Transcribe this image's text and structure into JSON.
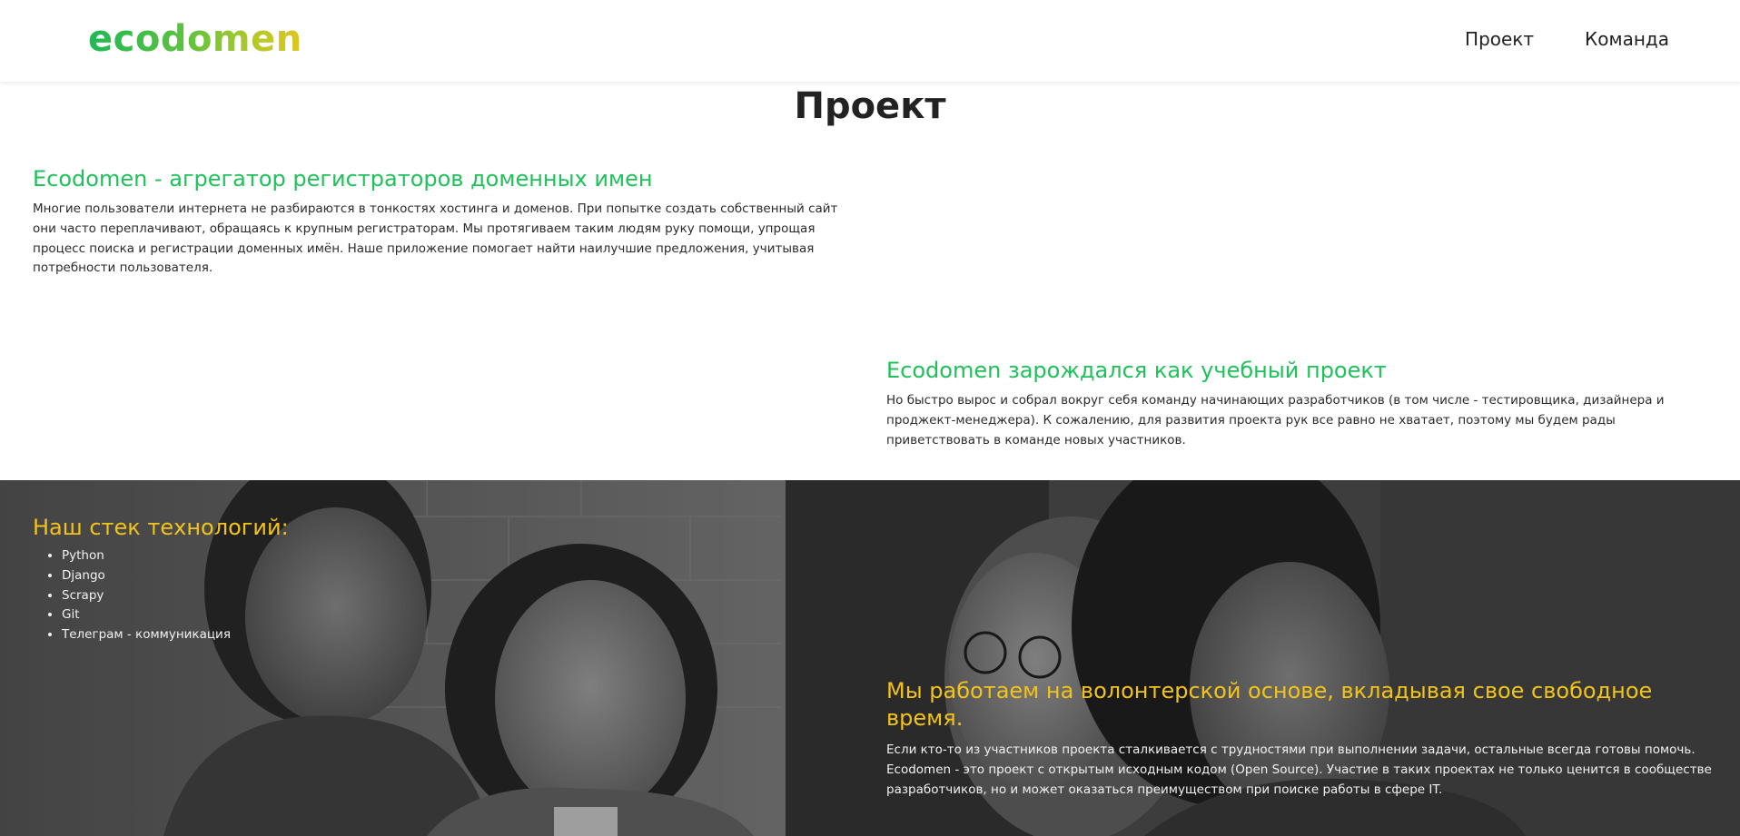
{
  "header": {
    "logo": "ecodomen",
    "nav": [
      {
        "label": "Проект"
      },
      {
        "label": "Команда"
      }
    ]
  },
  "page": {
    "title": "Проект"
  },
  "sections": {
    "aggregator": {
      "title": "Ecodomen - агрегатор регистраторов доменных имен",
      "text": "Многие пользователи интернета не разбираются в тонкостях хостинга и доменов. При попытке создать собственный сайт они часто переплачивают, обращаясь к крупным регистраторам. Мы протягиваем таким людям руку помощи, упрощая процесс поиска и регистрации доменных имён. Наше приложение помогает найти наилучшие предложения, учитывая потребности пользователя."
    },
    "origin": {
      "title": "Ecodomen зарождался как учебный проект",
      "text": "Но быстро вырос и собрал вокруг себя команду начинающих разработчиков (в том числе - тестировщика, дизайнера и проджект-менеджера). К сожалению, для развития проекта рук все равно не хватает, поэтому мы будем рады приветствовать в команде новых участников."
    },
    "stack": {
      "title": "Наш стек технологий:",
      "items": [
        "Python",
        "Django",
        "Scrapy",
        "Git",
        "Телеграм - коммуникация"
      ]
    },
    "volunteer": {
      "title": "Мы работаем на волонтерской основе, вкладывая свое свободное время.",
      "text": "Если кто-то из участников проекта сталкивается с трудностями при выполнении задачи, остальные всегда готовы помочь. Ecodomen - это проект с открытым исходным кодом (Open Source). Участие в таких проектах не только ценится в сообществе разработчиков, но и может оказаться преимуществом при поиске работы в сфере IT."
    }
  },
  "colors": {
    "accent_green": "#1fc15a",
    "accent_yellow": "#f2c319",
    "text_dark": "#2b2b2b",
    "photo_dark": "#3a3a3a"
  },
  "icons": {}
}
